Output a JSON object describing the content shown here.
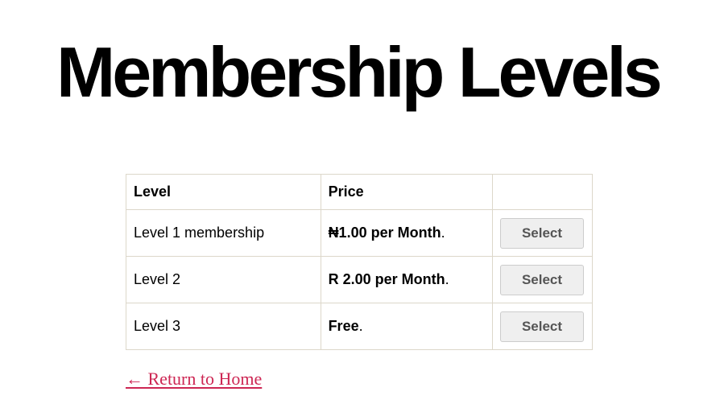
{
  "page": {
    "title": "Membership Levels"
  },
  "table": {
    "headers": {
      "level": "Level",
      "price": "Price",
      "action": ""
    },
    "rows": [
      {
        "level": "Level 1 membership",
        "price": "₦1.00 per Month",
        "price_suffix": ".",
        "button": "Select"
      },
      {
        "level": "Level 2",
        "price": "R 2.00 per Month",
        "price_suffix": ".",
        "button": "Select"
      },
      {
        "level": "Level 3",
        "price": "Free",
        "price_suffix": ".",
        "button": "Select"
      }
    ]
  },
  "footer": {
    "return_link": "← Return to Home"
  },
  "colors": {
    "link": "#cd2653",
    "border": "#dcd7ca",
    "button_bg": "#efefef",
    "button_text": "#555555"
  }
}
